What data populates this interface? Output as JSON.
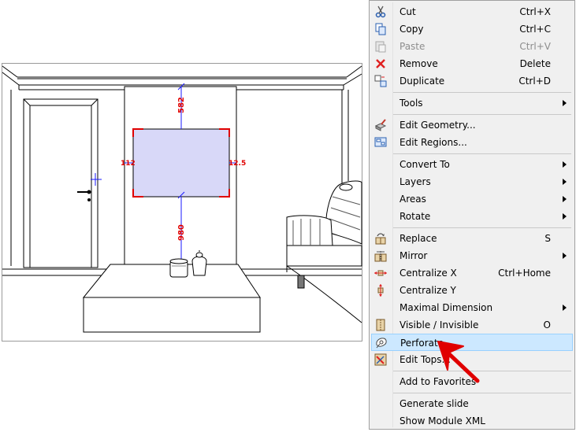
{
  "drawing": {
    "dim_top": "582",
    "dim_bottom": "980",
    "dim_left": "112",
    "dim_right": "12.5"
  },
  "menu": {
    "items": [
      {
        "label": "Cut",
        "shortcut": "Ctrl+X",
        "icon": "scissors-icon"
      },
      {
        "label": "Copy",
        "shortcut": "Ctrl+C",
        "icon": "copy-icon"
      },
      {
        "label": "Paste",
        "shortcut": "Ctrl+V",
        "icon": "paste-icon",
        "disabled": true
      },
      {
        "label": "Remove",
        "shortcut": "Delete",
        "icon": "red-x-icon"
      },
      {
        "label": "Duplicate",
        "shortcut": "Ctrl+D",
        "icon": "duplicate-icon"
      },
      {
        "label": "Tools",
        "submenu": true
      },
      {
        "label": "Edit Geometry...",
        "icon": "edit-geometry-icon"
      },
      {
        "label": "Edit Regions...",
        "icon": "edit-regions-icon"
      },
      {
        "label": "Convert To",
        "submenu": true
      },
      {
        "label": "Layers",
        "submenu": true
      },
      {
        "label": "Areas",
        "submenu": true
      },
      {
        "label": "Rotate",
        "submenu": true
      },
      {
        "label": "Replace",
        "shortcut": "S",
        "icon": "replace-icon"
      },
      {
        "label": "Mirror",
        "submenu": true,
        "icon": "mirror-icon"
      },
      {
        "label": "Centralize X",
        "shortcut": "Ctrl+Home",
        "icon": "centralize-x-icon"
      },
      {
        "label": "Centralize Y",
        "icon": "centralize-y-icon"
      },
      {
        "label": "Maximal Dimension",
        "submenu": true
      },
      {
        "label": "Visible / Invisible",
        "shortcut": "O",
        "icon": "visibility-icon"
      },
      {
        "label": "Perforate",
        "icon": "perforate-icon",
        "highlighted": true
      },
      {
        "label": "Edit Tops...",
        "icon": "edit-tops-icon"
      },
      {
        "label": "Add to Favorites"
      },
      {
        "label": "Generate slide"
      },
      {
        "label": "Show Module XML"
      }
    ]
  },
  "colors": {
    "menu_bg": "#f0f0f0",
    "highlight_bg": "#cce8ff",
    "highlight_border": "#99d1ff",
    "panel_fill": "#d8d8f8",
    "dimension_line": "#1a1aff",
    "dimension_text": "#e00000",
    "annotation_arrow": "#e00000"
  }
}
